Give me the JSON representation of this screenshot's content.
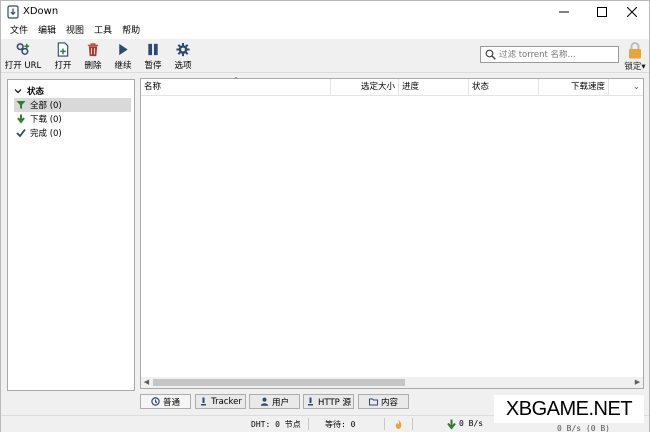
{
  "window": {
    "title": "XDown"
  },
  "menu": [
    "文件",
    "编辑",
    "视图",
    "工具",
    "帮助"
  ],
  "toolbar": {
    "buttons": [
      {
        "label": "打开 URL",
        "icon": "link-add-icon"
      },
      {
        "label": "打开",
        "icon": "file-open-icon"
      },
      {
        "label": "删除",
        "icon": "trash-icon"
      },
      {
        "label": "继续",
        "icon": "play-icon"
      },
      {
        "label": "暂停",
        "icon": "pause-icon"
      },
      {
        "label": "选项",
        "icon": "gear-icon"
      }
    ],
    "search_placeholder": "过滤 torrent 名称...",
    "lock_label": "锁定"
  },
  "sidebar": {
    "group": "状态",
    "items": [
      {
        "label": "全部 (0)",
        "icon": "filter-icon",
        "selected": true
      },
      {
        "label": "下载 (0)",
        "icon": "download-arrow-icon",
        "selected": false
      },
      {
        "label": "完成 (0)",
        "icon": "check-icon",
        "selected": false
      }
    ]
  },
  "list": {
    "columns": [
      "名称",
      "选定大小",
      "进度",
      "状态",
      "下载速度"
    ]
  },
  "tabs": [
    {
      "label": "普通",
      "icon": "general-icon"
    },
    {
      "label": "Tracker",
      "icon": "tracker-icon"
    },
    {
      "label": "用户",
      "icon": "users-icon"
    },
    {
      "label": "HTTP 源",
      "icon": "http-source-icon"
    },
    {
      "label": "内容",
      "icon": "folder-icon"
    }
  ],
  "status": {
    "dht": "DHT: 0 节点",
    "waiting": "等待: 0",
    "download_speed": "0 B/s",
    "upload_speed": "0 B/s (0 B)"
  },
  "watermark": "XBGAME.NET",
  "colors": {
    "accent_green": "#2e7d32",
    "accent_navy": "#2b4a6f",
    "delete_red": "#b03a2e",
    "lock_orange": "#e8a33b"
  }
}
